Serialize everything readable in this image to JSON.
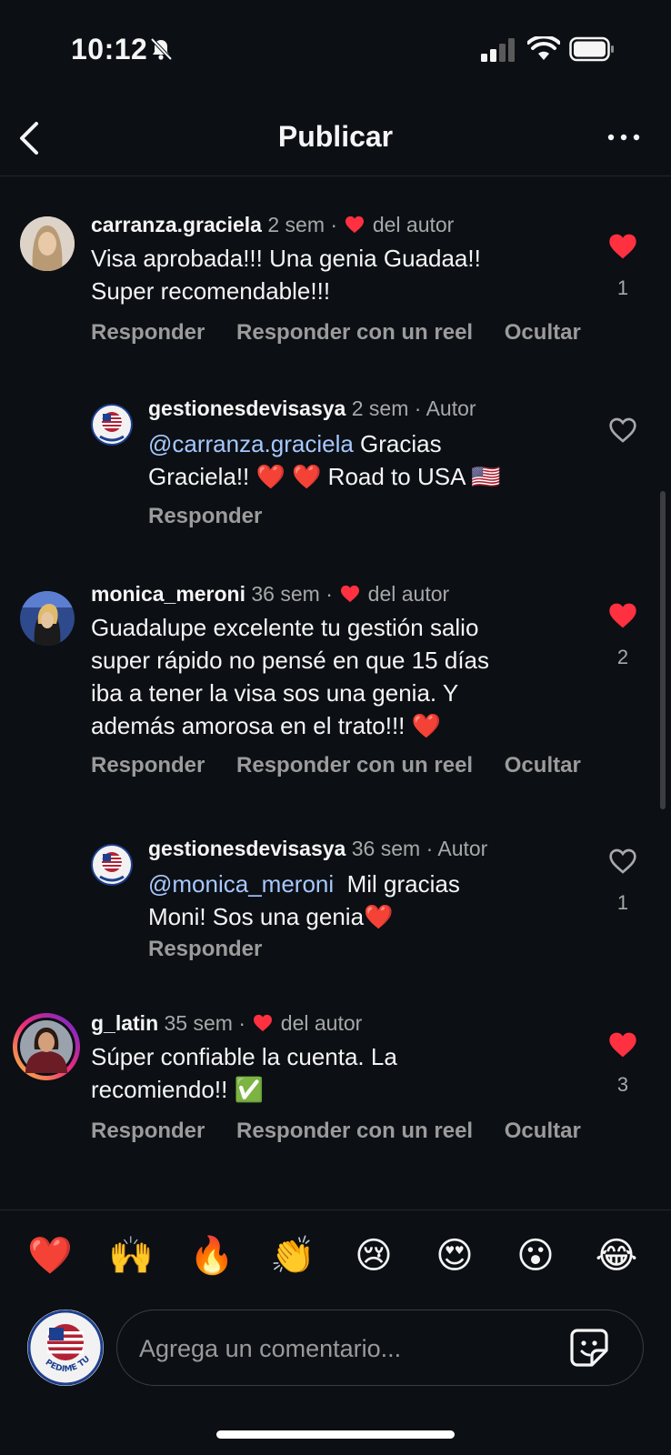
{
  "status": {
    "time": "10:12"
  },
  "header": {
    "title": "Publicar"
  },
  "comments": [
    {
      "username": "carranza.graciela",
      "time": "2 sem",
      "sep": "·",
      "badge": "del autor",
      "text_lines": [
        "Visa aprobada!!! Una genia Guadaa!!",
        "Super recomendable!!!"
      ],
      "likes": "1",
      "liked": true,
      "actions": [
        "Responder",
        "Responder con un reel",
        "Ocultar"
      ]
    },
    {
      "username": "gestionesdevisasya",
      "time": "2 sem",
      "sep": "·",
      "badge": "Autor",
      "mention": "@carranza.graciela",
      "text_lines": [
        " Gracias",
        "Graciela!! ❤️ ❤️  Road to USA 🇺🇸"
      ],
      "likes": "",
      "liked": false,
      "actions": [
        "Responder"
      ]
    },
    {
      "username": "monica_meroni",
      "time": "36 sem",
      "sep": "·",
      "badge": "del autor",
      "text_lines": [
        "Guadalupe  excelente  tu gestión  salio",
        "super rápido no pensé en que 15 días",
        "iba a tener la visa sos una genia. Y",
        "además amorosa en el trato!!! ❤️"
      ],
      "likes": "2",
      "liked": true,
      "actions": [
        "Responder",
        "Responder con un reel",
        "Ocultar"
      ]
    },
    {
      "username": "gestionesdevisasya",
      "time": "36 sem",
      "sep": "·",
      "badge": "Autor",
      "mention": "@monica_meroni",
      "text_lines": "  Mil gracias|Moni! Sos una genia❤️",
      "likes": "1",
      "liked": false,
      "actions": [
        "Responder"
      ]
    },
    {
      "username": "g_latin",
      "time": "35 sem",
      "sep": "·",
      "badge": "del autor",
      "text_lines": [
        "Súper confiable la cuenta. La",
        "recomiendo!! ✅"
      ],
      "likes": "3",
      "liked": true,
      "actions": [
        "Responder",
        "Responder con un reel",
        "Ocultar"
      ]
    }
  ],
  "reply4": {
    "line1": "  Mil gracias",
    "line2": "Moni! Sos una genia❤️"
  },
  "emojis": [
    "❤️",
    "🙌",
    "🔥",
    "👏",
    "😢",
    "😍",
    "😮",
    "😂"
  ],
  "composer": {
    "placeholder": "Agrega un comentario...",
    "avatar_text": "PEDIME TU VISA"
  },
  "colors": {
    "background": "#0c0f14",
    "like_red": "#ff3040",
    "mention_blue": "#a6c8ff"
  }
}
